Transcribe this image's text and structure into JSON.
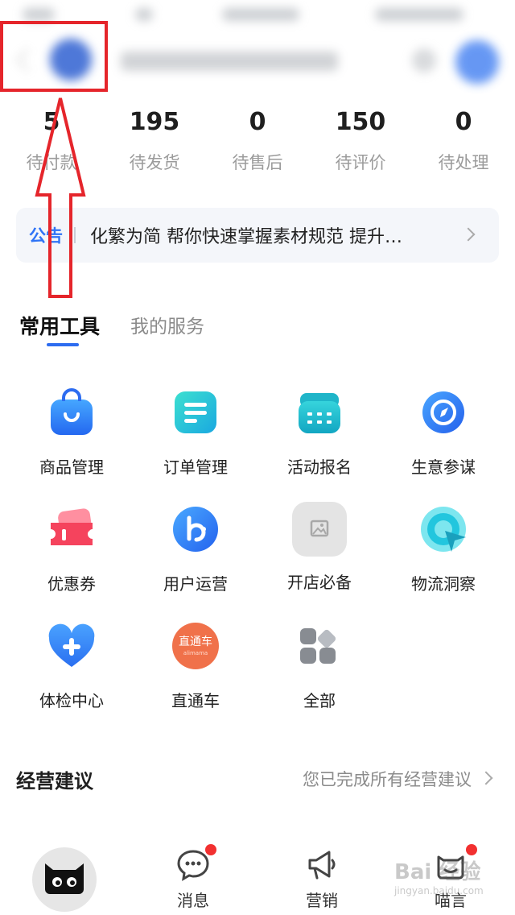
{
  "stats": [
    {
      "value": "5",
      "label": "待付款"
    },
    {
      "value": "195",
      "label": "待发货"
    },
    {
      "value": "0",
      "label": "待售后"
    },
    {
      "value": "150",
      "label": "待评价"
    },
    {
      "value": "0",
      "label": "待处理"
    }
  ],
  "notice": {
    "tag": "公告",
    "text": "化繁为简 帮你快速掌握素材规范 提升…"
  },
  "tabs": {
    "common_tools": "常用工具",
    "my_services": "我的服务"
  },
  "tools": [
    {
      "label": "商品管理",
      "icon": "shopping-bag-icon"
    },
    {
      "label": "订单管理",
      "icon": "order-list-icon"
    },
    {
      "label": "活动报名",
      "icon": "calendar-icon"
    },
    {
      "label": "生意参谋",
      "icon": "compass-icon"
    },
    {
      "label": "优惠券",
      "icon": "coupon-icon"
    },
    {
      "label": "用户运营",
      "icon": "user-ops-icon"
    },
    {
      "label": "开店必备",
      "icon": "image-placeholder-icon"
    },
    {
      "label": "物流洞察",
      "icon": "logistics-radar-icon"
    },
    {
      "label": "体检中心",
      "icon": "heart-plus-icon"
    },
    {
      "label": "直通车",
      "icon": "through-train-icon"
    },
    {
      "label": "全部",
      "icon": "all-apps-icon"
    }
  ],
  "through_train_badge": {
    "line1": "直通车",
    "line2": "alimama"
  },
  "suggestion": {
    "title": "经营建议",
    "status": "您已完成所有经营建议"
  },
  "bottom_nav": {
    "messages": "消息",
    "marketing": "营销",
    "miaoyan": "喵言"
  },
  "watermark": {
    "brand": "Bai 经验",
    "url": "jingyan.baidu.com"
  },
  "colors": {
    "accent": "#2d6cf0",
    "annotation_red": "#e5252b",
    "badge_red": "#f23030"
  }
}
